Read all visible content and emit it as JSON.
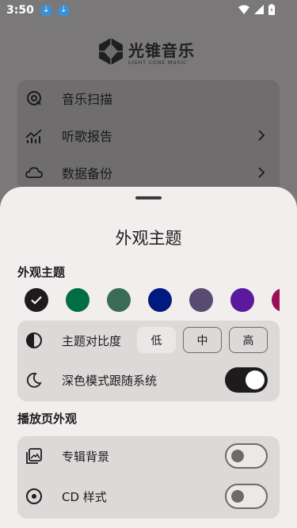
{
  "status_bar": {
    "time": "3:50"
  },
  "app": {
    "logo_title": "光锥音乐",
    "logo_subtitle": "LIGHT CONE MUSIC"
  },
  "menu": {
    "items": [
      {
        "label": "音乐扫描",
        "icon": "music-scan-icon",
        "has_chevron": false
      },
      {
        "label": "听歌报告",
        "icon": "chart-icon",
        "has_chevron": true
      },
      {
        "label": "数据备份",
        "icon": "cloud-icon",
        "has_chevron": true
      }
    ]
  },
  "sheet": {
    "title": "外观主题",
    "theme_section_label": "外观主题",
    "theme_colors": [
      "#1e1b1c",
      "#006d43",
      "#3b6a56",
      "#001a80",
      "#584b72",
      "#5b1a9e",
      "#9c0d57"
    ],
    "selected_color_index": 0,
    "contrast": {
      "label": "主题对比度",
      "options": [
        "低",
        "中",
        "高"
      ],
      "selected": "低"
    },
    "dark_mode": {
      "label": "深色模式跟随系统",
      "enabled": true
    },
    "player_section_label": "播放页外观",
    "album_background": {
      "label": "专辑背景",
      "enabled": false
    },
    "cd_style": {
      "label": "CD 样式",
      "enabled": false
    }
  }
}
